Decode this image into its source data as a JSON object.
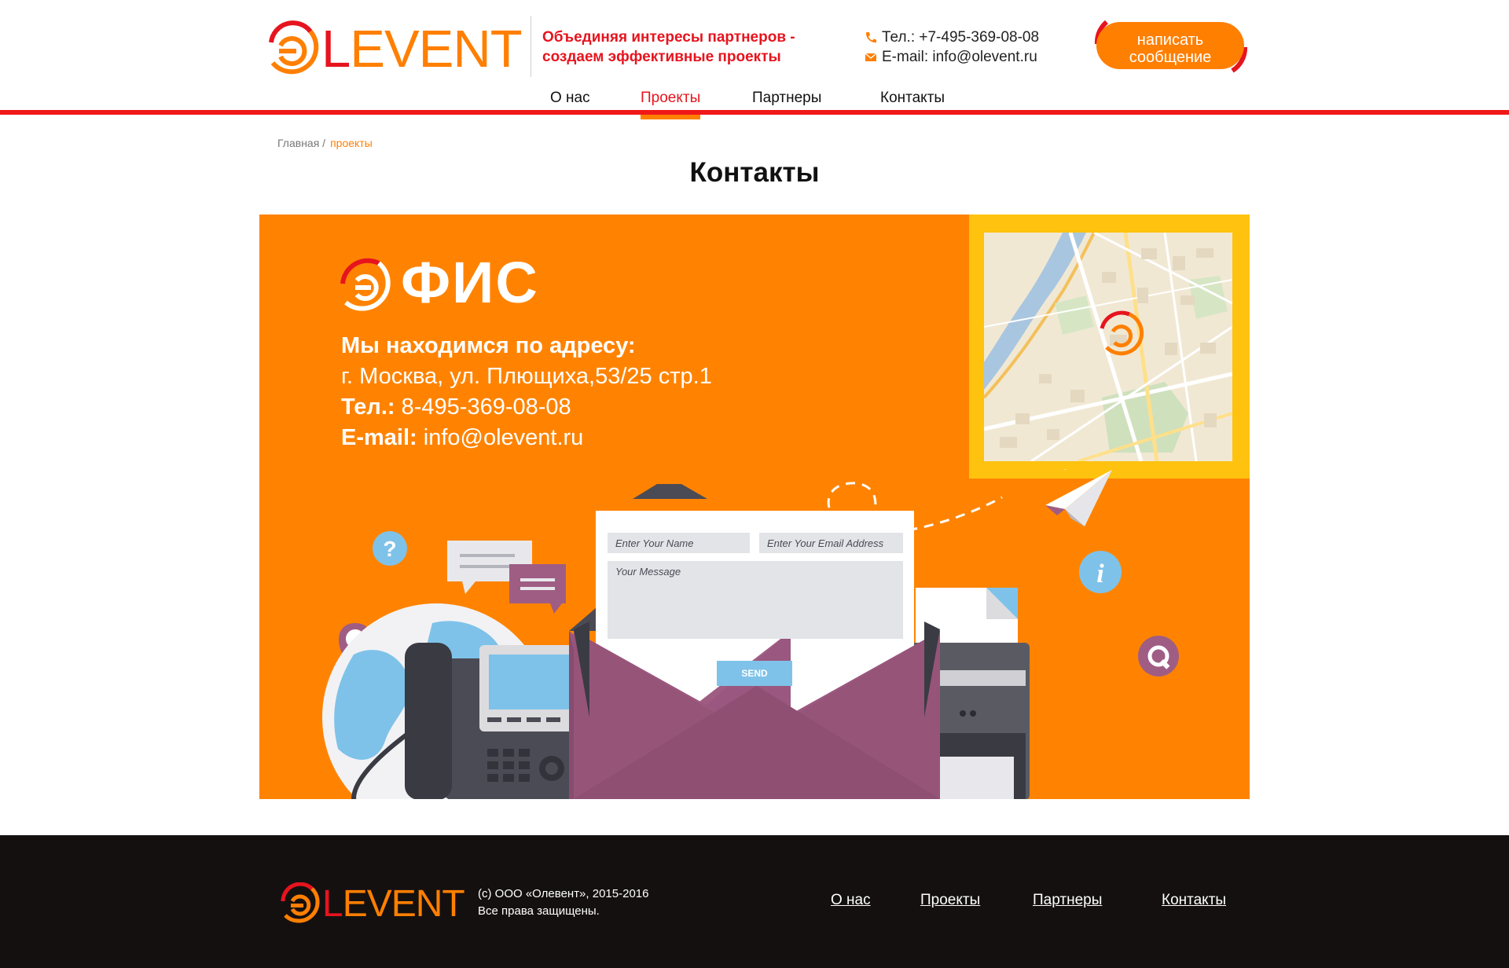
{
  "header": {
    "logo_prefix": "L",
    "logo_rest": "EVENT",
    "slogan_line1": "Объединяя интересы партнеров -",
    "slogan_line2": "создаем эффективные проекты",
    "phone": "Тел.: +7-495-369-08-08",
    "email": "E-mail: info@olevent.ru",
    "write_button_line1": "написать",
    "write_button_line2": "сообщение"
  },
  "nav": {
    "items": [
      {
        "label": "О нас"
      },
      {
        "label": "Проекты",
        "active": true
      },
      {
        "label": "Партнеры"
      },
      {
        "label": "Контакты"
      }
    ]
  },
  "breadcrumb": {
    "home": "Главная /",
    "current": "проекты"
  },
  "page_title": "Контакты",
  "banner": {
    "office_title": "ФИС",
    "address_heading": "Мы находимся по адресу:",
    "address": "г. Москва, ул. Плющиха,53/25 стр.1",
    "phone_label": "Тел.:",
    "phone_value": "8-495-369-08-08",
    "email_label": "E-mail:",
    "email_value": "info@olevent.ru",
    "form": {
      "name_placeholder": "Enter Your Name",
      "email_placeholder": "Enter Your Email Address",
      "message_placeholder": "Your Message",
      "send_label": "SEND"
    }
  },
  "footer": {
    "logo_prefix": "L",
    "logo_rest": "EVENT",
    "copyright_line1": "(c) ООО «Олевент», 2015-2016",
    "copyright_line2": "Все права защищены.",
    "nav": [
      "О нас",
      "Проекты",
      "Партнеры",
      "Контакты"
    ]
  },
  "colors": {
    "brand_orange": "#ff7f00",
    "brand_red": "#e6141e",
    "banner_bg": "#ff8300",
    "map_frame": "#ffc20e",
    "footer_bg": "#151010"
  }
}
